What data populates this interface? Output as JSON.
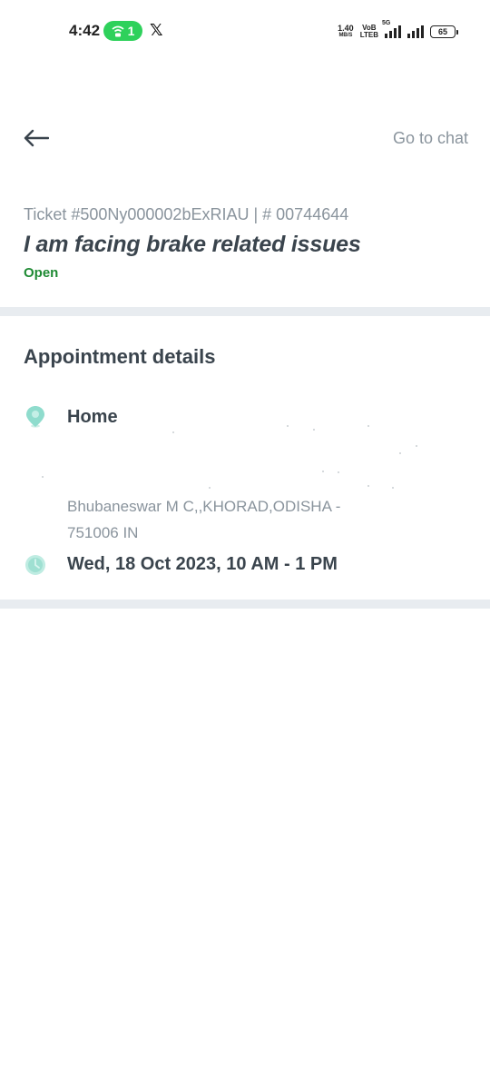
{
  "status_bar": {
    "time": "4:42",
    "hotspot_count": "1",
    "x_app": "𝕏",
    "net_speed": "1.40",
    "net_speed_unit": "MB/S",
    "volte_top": "VoB",
    "volte_bottom": "LTEB",
    "network_tag": "5G",
    "battery": "65"
  },
  "header": {
    "back_icon": "arrow-left-icon",
    "chat_link": "Go to chat"
  },
  "ticket": {
    "id_line": "Ticket #500Ny000002bExRIAU | # 00744644",
    "title": "I am facing brake related issues",
    "status": "Open",
    "status_color": "#1e8a33"
  },
  "appointment": {
    "section_title": "Appointment details",
    "location_icon": "map-pin-icon",
    "location_label": "Home",
    "address_line1": "Bhubaneswar M C,,KHORAD,ODISHA -",
    "address_line2": "751006 IN",
    "time_icon": "clock-icon",
    "time_slot": "Wed, 18 Oct 2023, 10 AM - 1 PM"
  },
  "colors": {
    "accent_teal": "#7fd6c6",
    "divider": "#e8ecf0",
    "muted_text": "#8a949d"
  }
}
